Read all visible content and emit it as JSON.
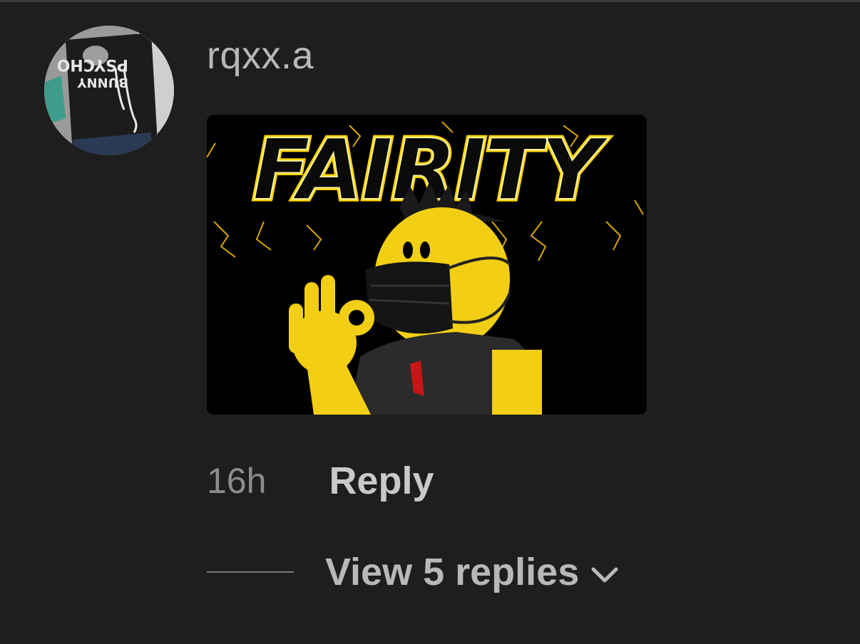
{
  "comment": {
    "username": "rqxx.a",
    "avatar_icon": "profile-photo-icon",
    "avatar_text_top": "PSYCHO",
    "avatar_text_bottom": "BUNNY",
    "attachment": {
      "banner_text": "FAIRITY",
      "accent_color": "#ffd400"
    },
    "timestamp": "16h",
    "reply_label": "Reply",
    "view_replies_label": "View 5 replies",
    "chevron_icon": "chevron-down-icon"
  },
  "colors": {
    "background": "#1e1e1e",
    "username": "#b8b8b8",
    "timestamp": "#8c8c8c",
    "reply": "#c9c9c9"
  }
}
